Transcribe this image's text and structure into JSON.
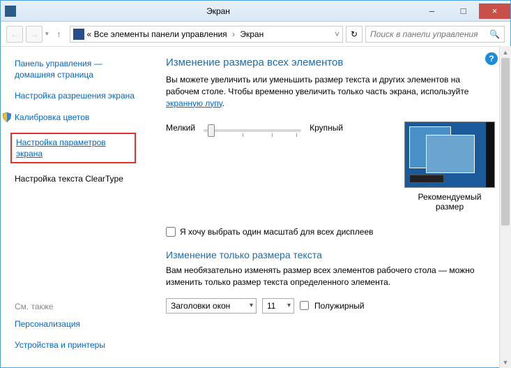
{
  "window": {
    "title": "Экран",
    "minimize": "–",
    "maximize": "□",
    "close": "×"
  },
  "nav": {
    "back": "←",
    "forward": "→",
    "up": "↑",
    "breadcrumb_root": "«",
    "breadcrumb_1": "Все элементы панели управления",
    "breadcrumb_2": "Экран",
    "refresh": "↻",
    "search_placeholder": "Поиск в панели управления",
    "search_icon": "🔍"
  },
  "sidebar": {
    "home": "Панель управления — домашняя страница",
    "resolution": "Настройка разрешения экрана",
    "calibration": "Калибровка цветов",
    "screen_params": "Настройка параметров экрана",
    "cleartype": "Настройка текста ClearType",
    "see_also": "См. также",
    "personalization": "Персонализация",
    "devices": "Устройства и принтеры"
  },
  "main": {
    "help": "?",
    "heading1": "Изменение размера всех элементов",
    "desc1_a": "Вы можете увеличить или уменьшить размер текста и других элементов на рабочем столе. Чтобы временно увеличить только часть экрана, используйте ",
    "desc1_link": "экранную лупу",
    "desc1_b": ".",
    "slider_min": "Мелкий",
    "slider_max": "Крупный",
    "recommended": "Рекомендуемый размер",
    "checkbox1": "Я хочу выбрать один масштаб для всех дисплеев",
    "heading2": "Изменение только размера текста",
    "desc2": "Вам необязательно изменять размер всех элементов рабочего стола — можно изменить только размер текста определенного элемента.",
    "select_element": "Заголовки окон",
    "select_size": "11",
    "bold": "Полужирный"
  }
}
